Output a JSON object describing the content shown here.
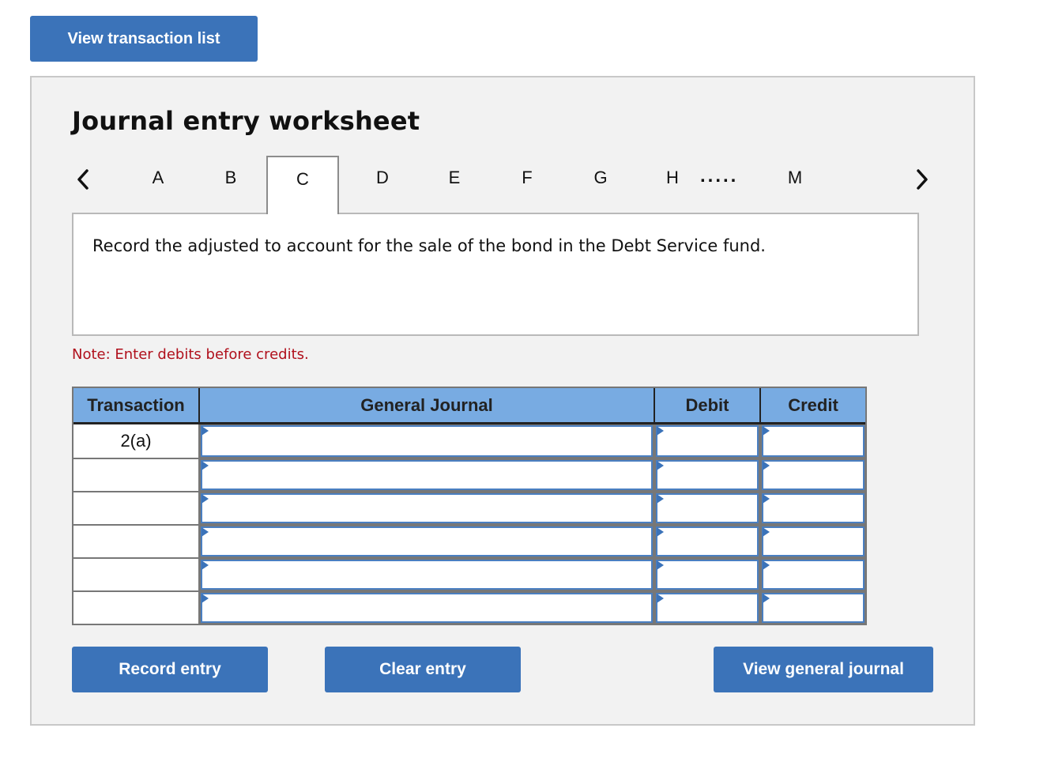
{
  "header": {
    "view_transaction_list_label": "View transaction list"
  },
  "worksheet": {
    "title": "Journal entry worksheet",
    "tabs": [
      {
        "label": "A",
        "active": false
      },
      {
        "label": "B",
        "active": false
      },
      {
        "label": "C",
        "active": true
      },
      {
        "label": "D",
        "active": false
      },
      {
        "label": "E",
        "active": false
      },
      {
        "label": "F",
        "active": false
      },
      {
        "label": "G",
        "active": false
      },
      {
        "label": "H",
        "active": false
      },
      {
        "label": "M",
        "active": false
      }
    ],
    "tab_ellipsis": ".....",
    "prev_icon": "chevron-left-icon",
    "next_icon": "chevron-right-icon",
    "prompt": "Record the adjusted to account for the sale of the bond in the Debt Service fund.",
    "note": "Note: Enter debits before credits."
  },
  "table": {
    "columns": [
      "Transaction",
      "General Journal",
      "Debit",
      "Credit"
    ],
    "rows": [
      {
        "transaction": "2(a)",
        "account": "",
        "debit": "",
        "credit": ""
      },
      {
        "transaction": "",
        "account": "",
        "debit": "",
        "credit": ""
      },
      {
        "transaction": "",
        "account": "",
        "debit": "",
        "credit": ""
      },
      {
        "transaction": "",
        "account": "",
        "debit": "",
        "credit": ""
      },
      {
        "transaction": "",
        "account": "",
        "debit": "",
        "credit": ""
      },
      {
        "transaction": "",
        "account": "",
        "debit": "",
        "credit": ""
      }
    ]
  },
  "actions": {
    "record_entry_label": "Record entry",
    "clear_entry_label": "Clear entry",
    "view_general_journal_label": "View general journal"
  },
  "colors": {
    "button_blue": "#3b73b9",
    "header_blue": "#78abe2",
    "note_red": "#b0101c",
    "panel_gray": "#f2f2f2"
  }
}
